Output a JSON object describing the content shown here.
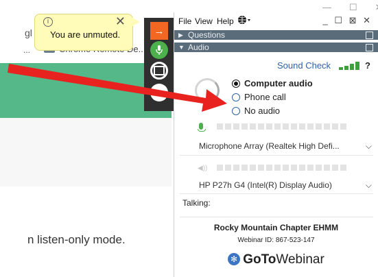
{
  "browser": {
    "fragment_g": "gl",
    "fragment_dots": "...",
    "chrome_tab_text": "Chrome Remote De...",
    "listen_only_text": "n listen-only mode."
  },
  "tooltip": {
    "message": "You are unmuted.",
    "info_glyph": "i",
    "close_glyph": "✕"
  },
  "control_strip": {
    "arrow_glyph": "→"
  },
  "panel": {
    "menu": {
      "file": "File",
      "view": "View",
      "help": "Help",
      "window_controls": "_ ☐ ⊠ ✕"
    },
    "sections": [
      {
        "label": "Questions",
        "expanded": false
      },
      {
        "label": "Audio",
        "expanded": true
      }
    ],
    "sound_check": "Sound Check",
    "help_q": "?",
    "audio_options": [
      {
        "label": "Computer audio",
        "selected": true
      },
      {
        "label": "Phone call",
        "selected": false
      },
      {
        "label": "No audio",
        "selected": false
      }
    ],
    "microphone": "Microphone Array (Realtek High Defi...",
    "speaker": "HP P27h G4 (Intel(R) Display Audio)",
    "talking_label": "Talking:",
    "org_name": "Rocky Mountain Chapter EHMM",
    "webinar_id": "Webinar ID: 867-523-147",
    "logo": {
      "bold": "GoTo",
      "regular": "Webinar"
    }
  },
  "colors": {
    "accent_orange": "#f26722",
    "mic_green": "#4cb04c",
    "section_bar": "#5a6b7a",
    "link_blue": "#2f60a8",
    "pointer_red": "#e8231f"
  }
}
